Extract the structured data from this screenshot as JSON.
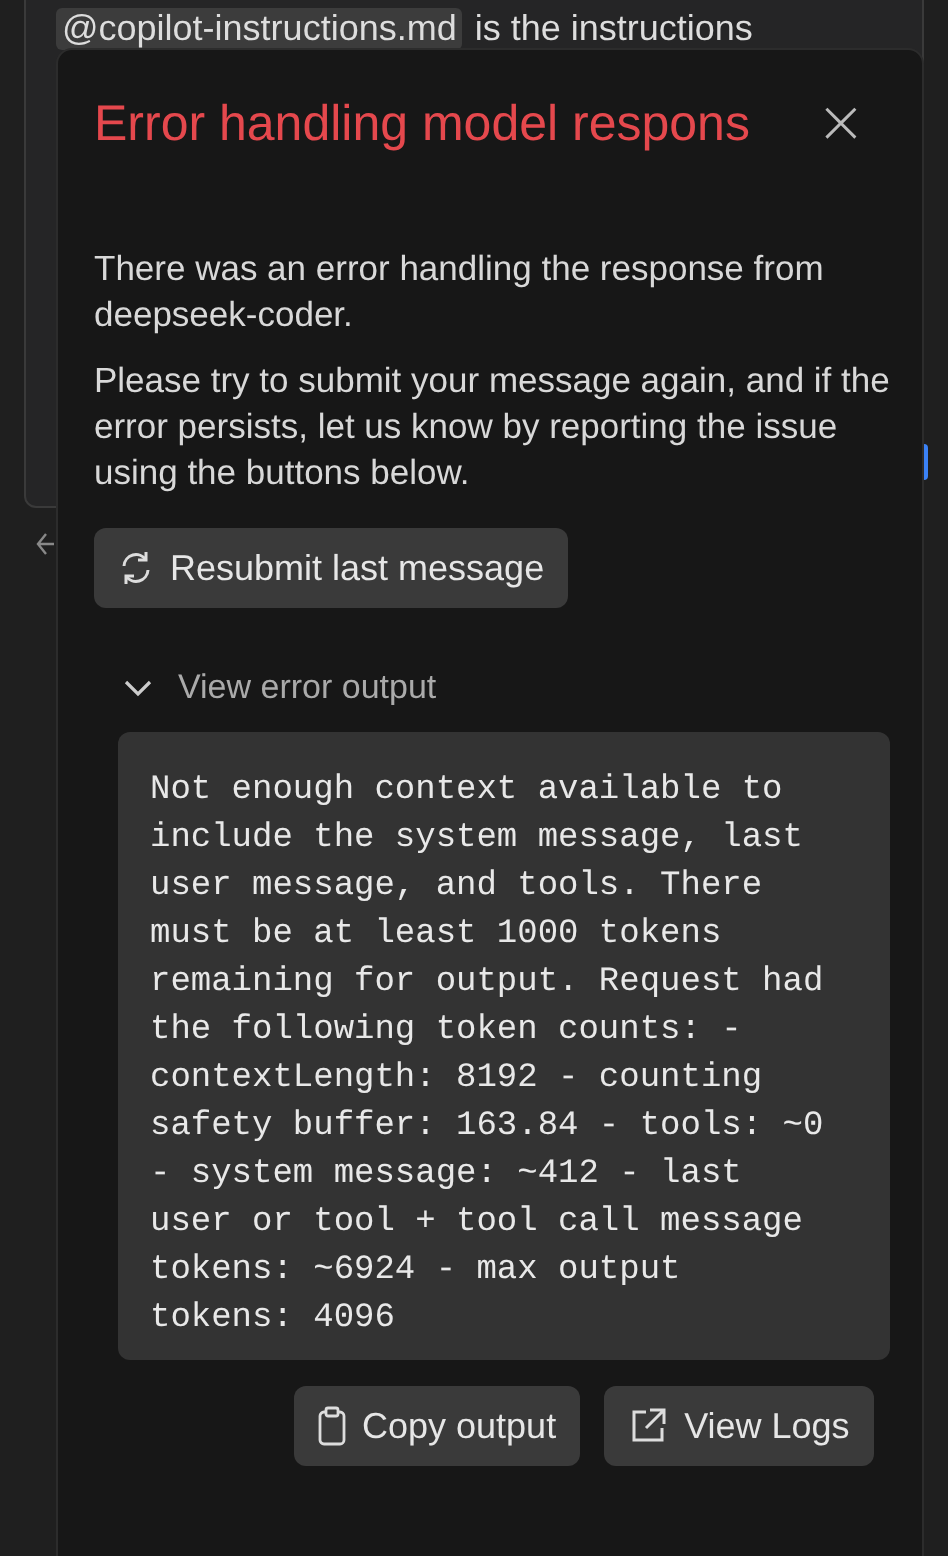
{
  "background_message": {
    "mention": "@copilot-instructions.md",
    "text": "is the instructions"
  },
  "dialog": {
    "title": "Error handling model respons",
    "close": "×",
    "paragraphs": [
      "There was an error handling the response from deepseek-coder.",
      "Please try to submit your message again, and if the error persists, let us know by reporting the issue using the buttons below."
    ],
    "resubmit_button": "Resubmit last message",
    "error_output": {
      "label": "View error output",
      "expanded": true,
      "text": "Not enough context available to include the system message, last user message, and tools. There must be at least 1000 tokens remaining for output. Request had the following token counts: - contextLength: 8192 - counting safety buffer: 163.84 - tools: ~0 - system message: ~412 - last user or tool + tool call message tokens: ~6924 - max output tokens: 4096"
    },
    "buttons": [
      {
        "kind": "copy",
        "label": "Copy output"
      },
      {
        "kind": "external",
        "label": "View Logs"
      }
    ]
  }
}
